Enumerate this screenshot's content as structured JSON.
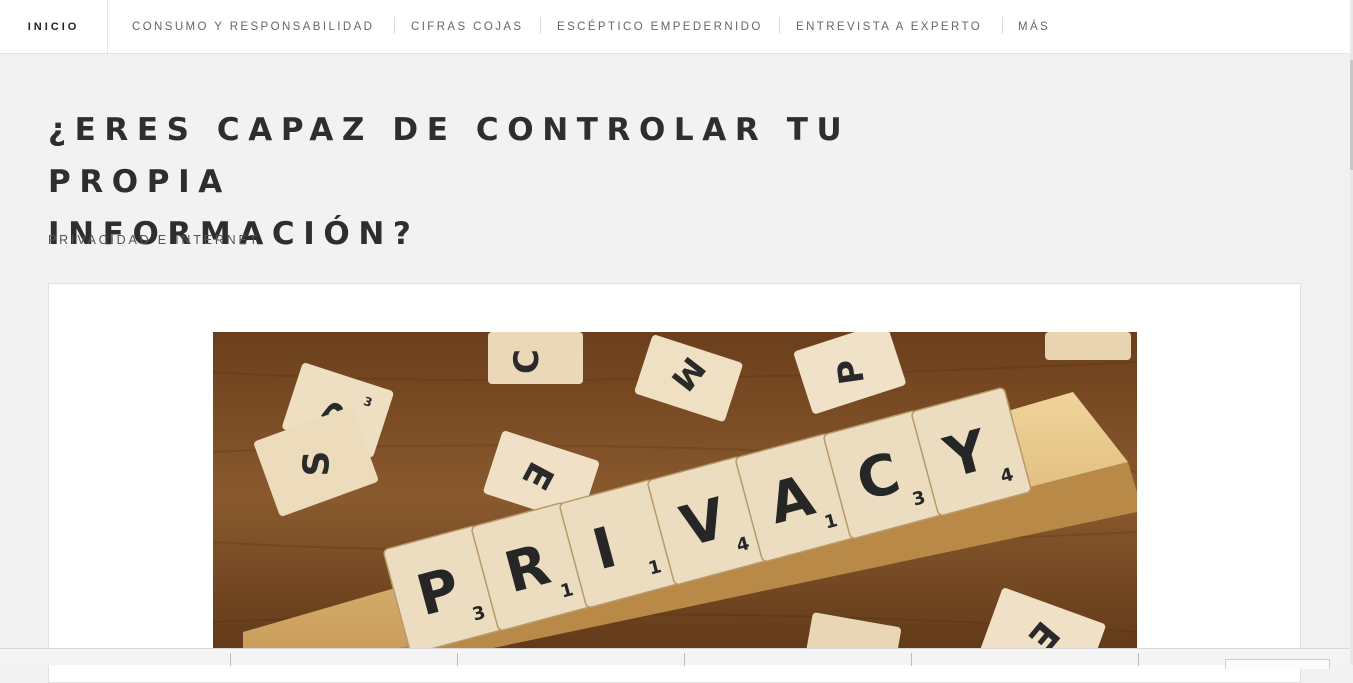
{
  "nav": {
    "home": "INICIO",
    "items": [
      "CONSUMO Y RESPONSABILIDAD",
      "CIFRAS COJAS",
      "ESCÉPTICO EMPEDERNIDO",
      "ENTREVISTA A EXPERTO",
      "MÁS"
    ]
  },
  "article": {
    "title_line1": "¿ERES CAPAZ DE CONTROLAR TU PROPIA",
    "title_line2": "INFORMACIÓN?",
    "subtitle": "PRIVACIDAD E INTERNET"
  },
  "hero_image": {
    "word": "PRIVACY",
    "tiles": [
      {
        "letter": "P",
        "value": "3"
      },
      {
        "letter": "R",
        "value": "1"
      },
      {
        "letter": "I",
        "value": "1"
      },
      {
        "letter": "V",
        "value": "4"
      },
      {
        "letter": "A",
        "value": "1"
      },
      {
        "letter": "C",
        "value": "3"
      },
      {
        "letter": "Y",
        "value": "4"
      }
    ]
  },
  "colors": {
    "page_bg": "#f2f2f2",
    "title": "#2e2e2e",
    "nav_text": "#666666",
    "wood_dark": "#7a4a22",
    "tile": "#ecdcc0"
  }
}
